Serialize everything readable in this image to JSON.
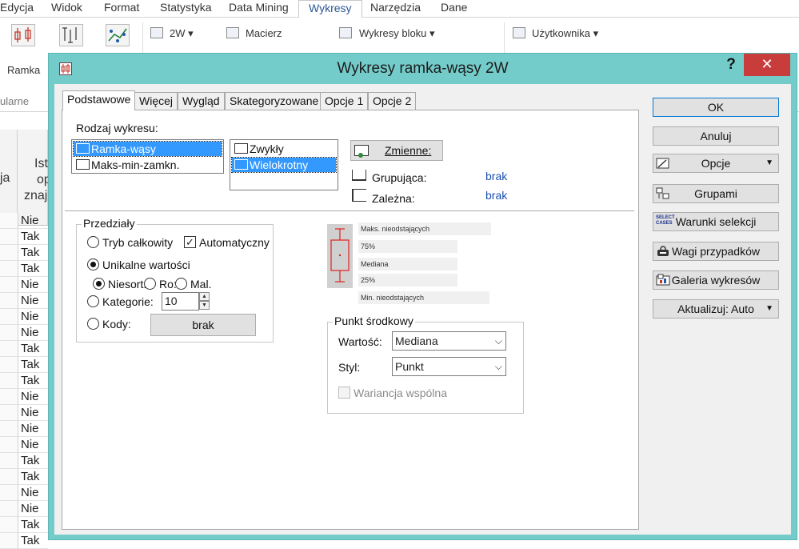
{
  "menu": {
    "items": [
      "Edycja",
      "Widok",
      "Format",
      "Statystyka",
      "Data Mining",
      "Wykresy",
      "Narzędzia",
      "Dane"
    ],
    "active": "Wykresy"
  },
  "ribbon": {
    "ramka_label": "Ramka",
    "group_label": "ularne",
    "two_w": "2W",
    "macierz": "Macierz",
    "wykresy_bloku": "Wykresy bloku",
    "uzytkownika": "Użytkownika"
  },
  "sheet": {
    "header_left": [
      "ja"
    ],
    "header_right": [
      "Ist",
      "op",
      "znaj"
    ],
    "cells": [
      "Nie",
      "Tak",
      "Tak",
      "Tak",
      "Nie",
      "Nie",
      "Nie",
      "Nie",
      "Tak",
      "Tak",
      "Tak",
      "Nie",
      "Nie",
      "Nie",
      "Nie",
      "Tak",
      "Tak",
      "Nie",
      "Nie",
      "Tak",
      "Tak"
    ]
  },
  "dialog": {
    "title": "Wykresy ramka-wąsy 2W",
    "help": "?",
    "close": "✕",
    "tabs": [
      "Podstawowe",
      "Więcej",
      "Wygląd",
      "Skategoryzowane",
      "Opcje 1",
      "Opcje 2"
    ],
    "selected_tab": "Podstawowe",
    "rodzaj_label": "Rodzaj wykresu:",
    "rodzaj_items": [
      "Ramka-wąsy",
      "Maks-min-zamkn."
    ],
    "rodzaj_selected": "Ramka-wąsy",
    "mode_items": [
      "Zwykły",
      "Wielokrotny"
    ],
    "mode_selected": "Wielokrotny",
    "zmienne_btn": "Zmienne:",
    "grupujaca_label": "Grupująca:",
    "grupujaca_val": "brak",
    "zalezna_label": "Zależna:",
    "zalezna_val": "brak",
    "przedzialy": {
      "title": "Przedziały",
      "tryb": "Tryb całkowity",
      "automatyczny": "Automatyczny",
      "unikalne": "Unikalne wartości",
      "niesort": "Niesort.",
      "ro": "Ro:",
      "mal": "Mal.",
      "kategorie": "Kategorie:",
      "kategorie_val": "10",
      "kody": "Kody:",
      "kody_btn": "brak"
    },
    "legend": {
      "max": "Maks. nieodstających",
      "q75": "75%",
      "median": "Mediana",
      "q25": "25%",
      "min": "Min. nieodstających"
    },
    "punkt": {
      "title": "Punkt środkowy",
      "wartosc_label": "Wartość:",
      "wartosc_val": "Mediana",
      "styl_label": "Styl:",
      "styl_val": "Punkt",
      "wariancja": "Wariancja wspólna"
    },
    "side_buttons": {
      "ok": "OK",
      "anuluj": "Anuluj",
      "opcje": "Opcje",
      "grupami": "Grupami",
      "warunki": "Warunki selekcji",
      "wagi": "Wagi przypadków",
      "galeria": "Galeria wykresów",
      "aktualizuj": "Aktualizuj: Auto",
      "select_cases_icon_text": "SELECT CASES"
    }
  },
  "colors": {
    "dialog_frame": "#74ccca",
    "close_red": "#c83c3c",
    "selection_blue": "#3399ff",
    "value_blue": "#1a4fb0",
    "box_red": "#e02020"
  }
}
